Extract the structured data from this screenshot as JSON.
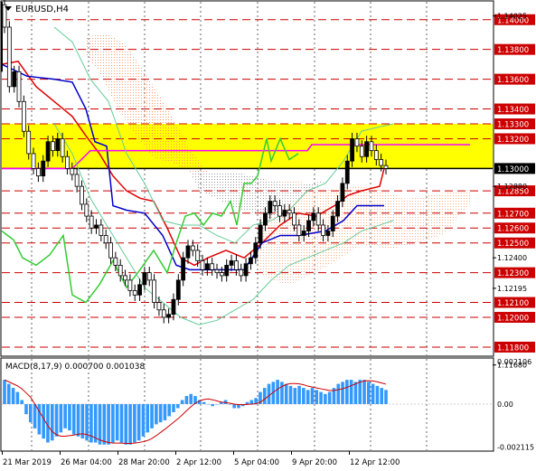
{
  "header": {
    "symbol": "EURUSD,H4"
  },
  "price_panel": {
    "levels": [
      {
        "label": "1.14000",
        "value": 1.14,
        "style": "red-dash"
      },
      {
        "label": "1.13800",
        "value": 1.138,
        "style": "red-dash"
      },
      {
        "label": "1.13600",
        "value": 1.136,
        "style": "red-dash"
      },
      {
        "label": "1.13400",
        "value": 1.134,
        "style": "red-dash"
      },
      {
        "label": "1.13300",
        "value": 1.133,
        "style": "red-dash"
      },
      {
        "label": "1.13200",
        "value": 1.132,
        "style": "red-dash"
      },
      {
        "label": "1.13000",
        "value": 1.13,
        "style": "black-solid"
      },
      {
        "label": "1.12850",
        "value": 1.1285,
        "style": "red-dash"
      },
      {
        "label": "1.12700",
        "value": 1.127,
        "style": "red-dash"
      },
      {
        "label": "1.12600",
        "value": 1.126,
        "style": "red-dash"
      },
      {
        "label": "1.12500",
        "value": 1.125,
        "style": "red-dash"
      },
      {
        "label": "1.12300",
        "value": 1.123,
        "style": "red-dash"
      },
      {
        "label": "1.12100",
        "value": 1.121,
        "style": "red-dash"
      },
      {
        "label": "1.12000",
        "value": 1.12,
        "style": "red-dash"
      },
      {
        "label": "1.11800",
        "value": 1.118,
        "style": "red-dash"
      }
    ],
    "axis_ticks": [
      {
        "label": "1.14025",
        "value": 1.14025
      },
      {
        "label": "1.12880",
        "value": 1.1288
      },
      {
        "label": "1.12400",
        "value": 1.124
      },
      {
        "label": "1.12195",
        "value": 1.12195
      },
      {
        "label": "1.11680",
        "value": 1.1168
      }
    ],
    "highlight_zone": {
      "from": 1.13,
      "to": 1.133,
      "color": "#ffff00"
    },
    "current_price": 1.13
  },
  "macd_panel": {
    "title": "MACD(8,17,9) 0.000700 0.001038",
    "axis_ticks": [
      {
        "label": "0.002106",
        "value": 0.002106
      },
      {
        "label": "0.00",
        "value": 0.0
      },
      {
        "label": "-0.002115",
        "value": -0.002115
      }
    ]
  },
  "time_axis": {
    "labels": [
      "21 Mar 2019",
      "26 Mar 04:00",
      "28 Mar 20:00",
      "2 Apr 12:00",
      "5 Apr 04:00",
      "9 Apr 20:00",
      "12 Apr 12:00"
    ]
  },
  "colors": {
    "candles": "#000000",
    "bull_fill": "#000000",
    "bear_fill": "#ffffff",
    "fast_ma": "#e00000",
    "slow_ma": "#0000cc",
    "oscillator": "#33cc33",
    "ichimoku_line": "#ff00ff",
    "ichimoku_cloud": "#ff9966",
    "lower_cloud": "#999999",
    "envelope": "#66cc99",
    "macd_hist": "#3399ff",
    "macd_signal": "#cc0000",
    "level_line": "#cc0000"
  }
}
